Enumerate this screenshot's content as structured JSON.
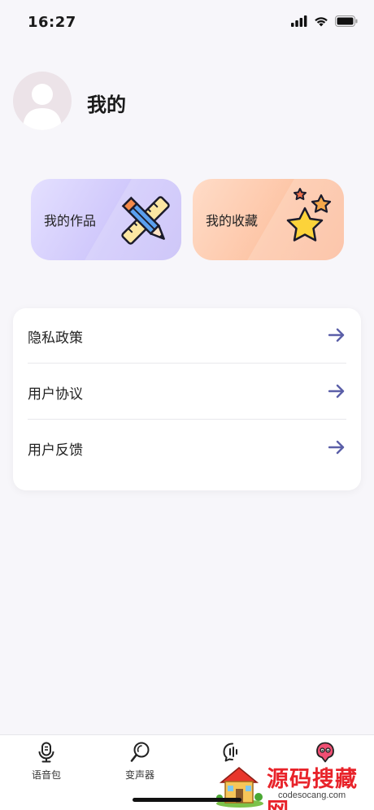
{
  "status_bar": {
    "time": "16:27"
  },
  "profile": {
    "title": "我的"
  },
  "cards": {
    "works_label": "我的作品",
    "favorites_label": "我的收藏"
  },
  "menu": {
    "items": [
      {
        "label": "隐私政策"
      },
      {
        "label": "用户协议"
      },
      {
        "label": "用户反馈"
      }
    ]
  },
  "tab_bar": {
    "tabs": [
      {
        "label": "语音包",
        "icon": "microphone-icon"
      },
      {
        "label": "变声器",
        "icon": "voice-changer-icon"
      },
      {
        "label": "",
        "icon": "chat-icon"
      },
      {
        "label": "",
        "icon": "profile-icon",
        "active": true
      }
    ]
  },
  "watermark": {
    "title": "源码搜藏网",
    "subtitle": "codesocang.com"
  },
  "colors": {
    "accent": "#5b5fa8",
    "active_tab": "#f04f73"
  }
}
